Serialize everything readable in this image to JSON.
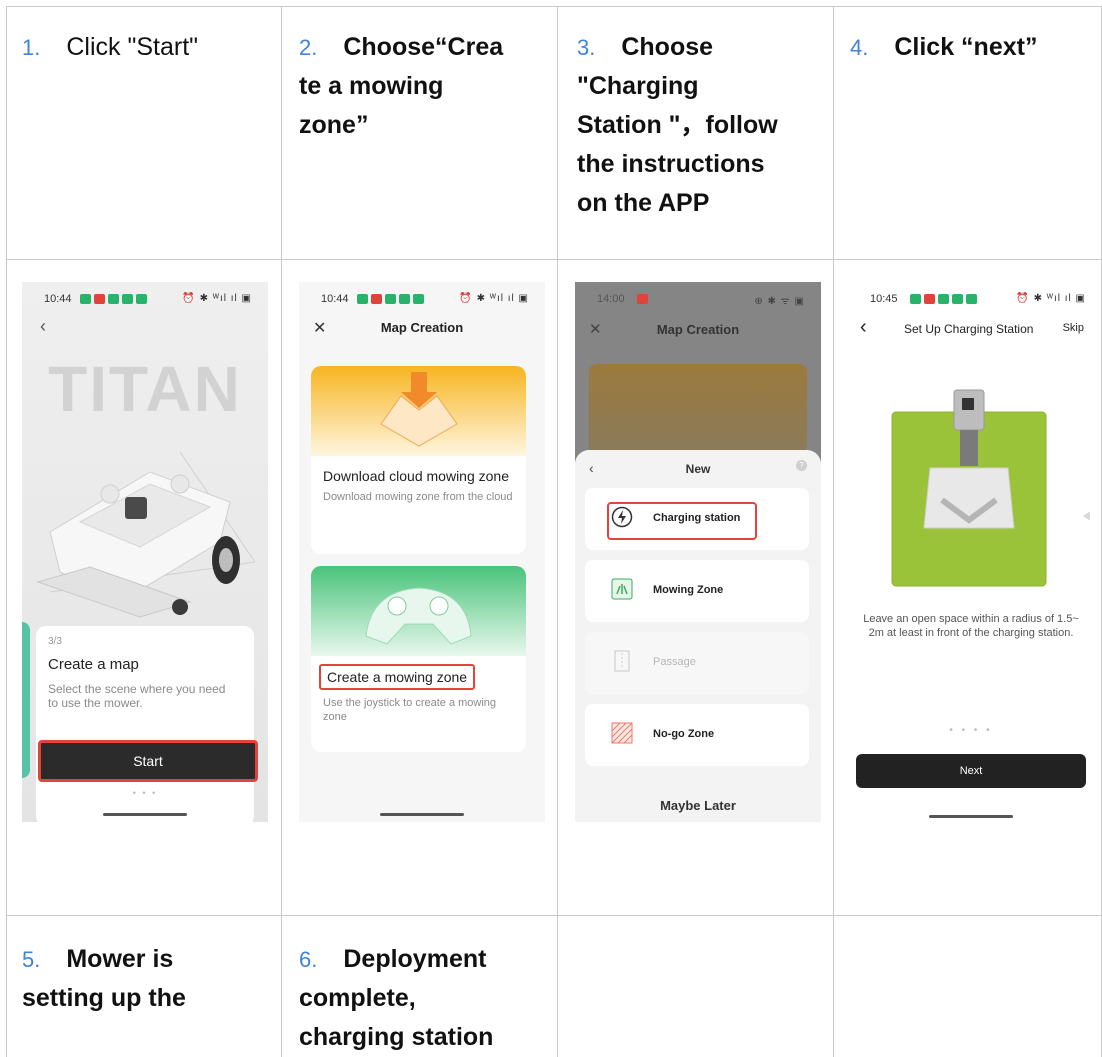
{
  "steps": [
    {
      "num": "1.",
      "text": "Click \"Start\""
    },
    {
      "num": "2.",
      "line1": "Choose“Crea",
      "line2": "te a mowing",
      "line3": "zone”"
    },
    {
      "num": "3.",
      "line1": "Choose",
      "line2": "\"Charging",
      "line3": "Station \"，follow",
      "line4": "the instructions",
      "line5": "on the APP"
    },
    {
      "num": "4.",
      "text": "Click “next”"
    },
    {
      "num": "5.",
      "line1": "Mower is",
      "line2": "setting up the"
    },
    {
      "num": "6.",
      "line1": "Deployment",
      "line2": "complete,",
      "line3": "charging station"
    }
  ],
  "phone1": {
    "time": "10:44",
    "system": "⏰ ✱ ᵂ​ıl ıl ▣",
    "brand": "TITAN",
    "page": "3/3",
    "card_title": "Create a map",
    "card_desc": "Select the scene where you need to use the mower.",
    "start": "Start",
    "dots": "• • •"
  },
  "phone2": {
    "time": "10:44",
    "system": "⏰ ✱ ᵂ​ıl ıl ▣",
    "header": "Map Creation",
    "tile1_title": "Download cloud mowing zone",
    "tile1_desc": "Download mowing zone from the cloud",
    "tile2_title": "Create a mowing zone",
    "tile2_desc": "Use the joystick to create a mowing zone"
  },
  "phone3": {
    "time": "14:00",
    "header": "Map Creation",
    "sheet_title": "New",
    "options": [
      "Charging station",
      "Mowing Zone",
      "Passage",
      "No-go Zone"
    ],
    "later": "Maybe Later"
  },
  "phone4": {
    "time": "10:45",
    "system": "⏰ ✱ ᵂ​ıl ıl ▣",
    "header": "Set Up Charging Station",
    "skip": "Skip",
    "desc_line1": "Leave an open space within a radius of 1.5~",
    "desc_line2": "2m at least in front of the charging station.",
    "dots": "• • • •",
    "next": "Next"
  },
  "colors": {
    "accent_red": "#e0453c",
    "step_number": "#3f84d6",
    "teal": "#57c3a6"
  }
}
